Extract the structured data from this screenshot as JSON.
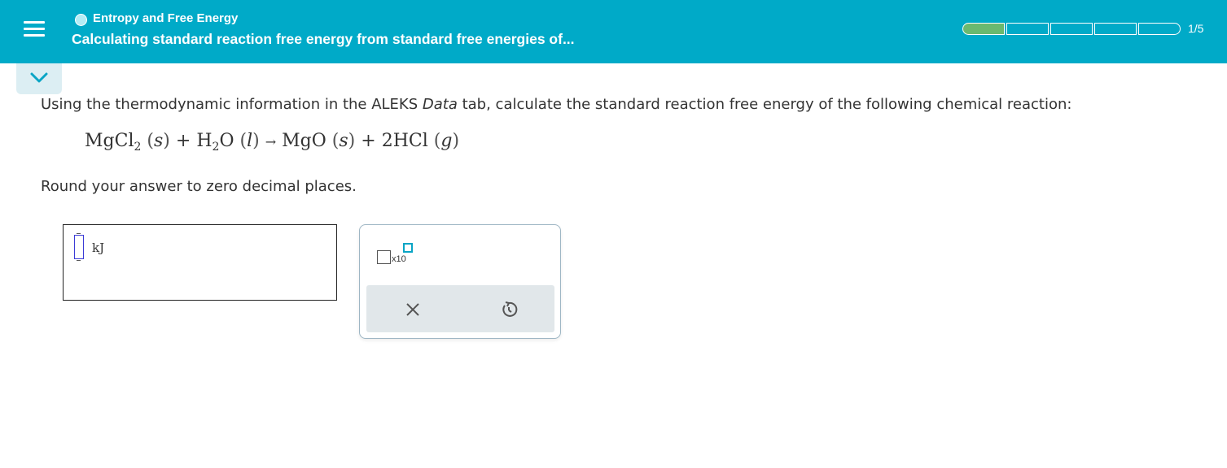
{
  "header": {
    "menu_icon": "hamburger-menu-icon",
    "topic": "Entropy and Free Energy",
    "title": "Calculating standard reaction free energy from standard free energies of...",
    "progress_text": "1/5",
    "progress": {
      "completed": 1,
      "total": 5
    },
    "colors": {
      "bar": "#00aac8",
      "progress_done": "#6ab96f"
    }
  },
  "collapse": {
    "icon": "chevron-down-icon"
  },
  "question": {
    "prompt_before": "Using the thermodynamic information in the ALEKS ",
    "prompt_italic": "Data",
    "prompt_after": " tab, calculate the standard reaction free energy of the following chemical reaction:",
    "equation": {
      "r1": "MgCl",
      "r1_sub": "2",
      "r1_phase": "s",
      "plus1": "+",
      "r2a": "H",
      "r2_sub": "2",
      "r2b": "O",
      "r2_phase": "l",
      "arrow": "→",
      "p1": "MgO",
      "p1_phase": "s",
      "plus2": "+",
      "p2": "2HCl",
      "p2_phase": "g"
    },
    "round_note": "Round your answer to zero decimal places."
  },
  "answer": {
    "value": "",
    "unit": "kJ"
  },
  "tools": {
    "sci_label": "x10",
    "sci_icon": "scientific-notation-icon",
    "clear_icon": "close-icon",
    "undo_icon": "undo-icon"
  }
}
